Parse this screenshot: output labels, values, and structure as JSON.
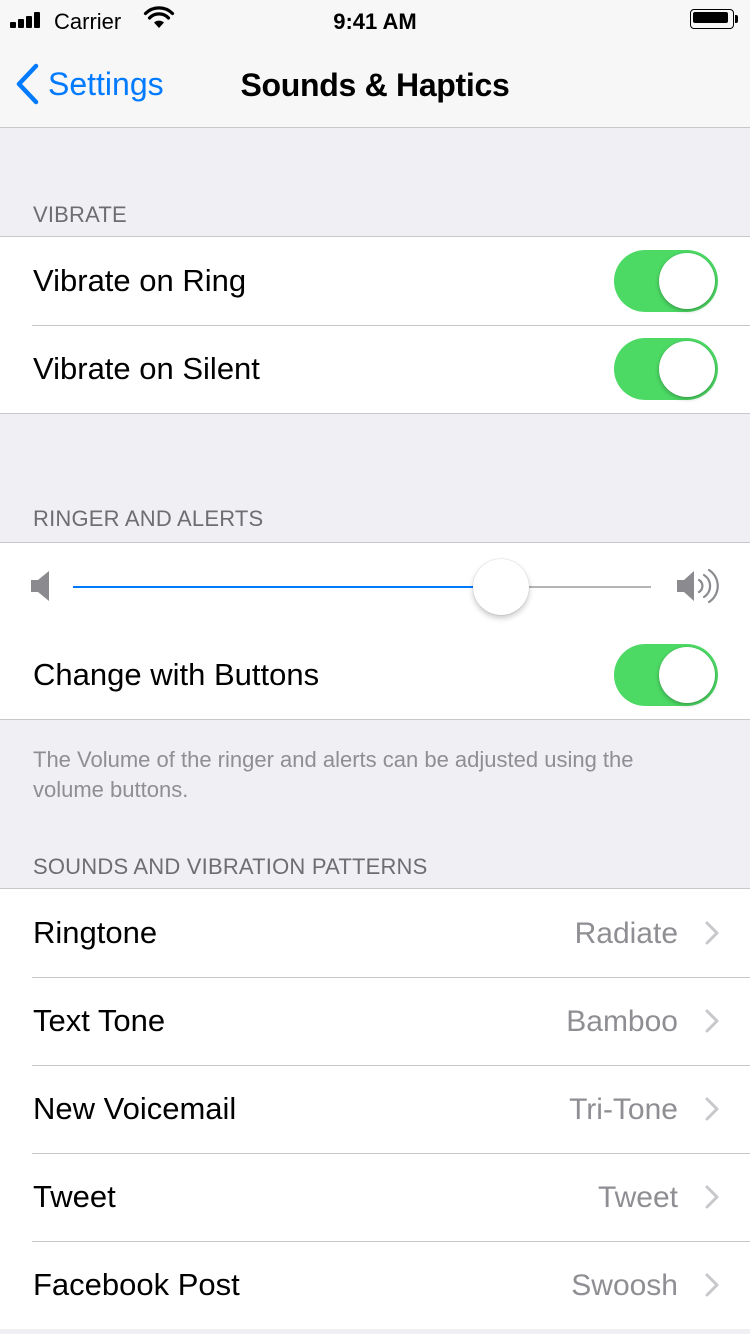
{
  "status_bar": {
    "carrier": "Carrier",
    "time": "9:41 AM"
  },
  "nav": {
    "back_label": "Settings",
    "title": "Sounds & Haptics"
  },
  "vibrate": {
    "header": "VIBRATE",
    "rows": [
      {
        "label": "Vibrate on Ring",
        "on": true
      },
      {
        "label": "Vibrate on Silent",
        "on": true
      }
    ]
  },
  "ringer": {
    "header": "RINGER AND ALERTS",
    "volume_fraction": 0.74,
    "change_with_buttons": {
      "label": "Change with Buttons",
      "on": true
    },
    "footer": "The Volume of the ringer and alerts can be adjusted using the volume buttons."
  },
  "sounds": {
    "header": "SOUNDS AND VIBRATION PATTERNS",
    "rows": [
      {
        "label": "Ringtone",
        "value": "Radiate"
      },
      {
        "label": "Text Tone",
        "value": "Bamboo"
      },
      {
        "label": "New Voicemail",
        "value": "Tri-Tone"
      },
      {
        "label": "Tweet",
        "value": "Tweet"
      },
      {
        "label": "Facebook Post",
        "value": "Swoosh"
      }
    ]
  },
  "colors": {
    "accent": "#007aff",
    "toggle_on": "#4cd964",
    "background": "#efeff4"
  }
}
